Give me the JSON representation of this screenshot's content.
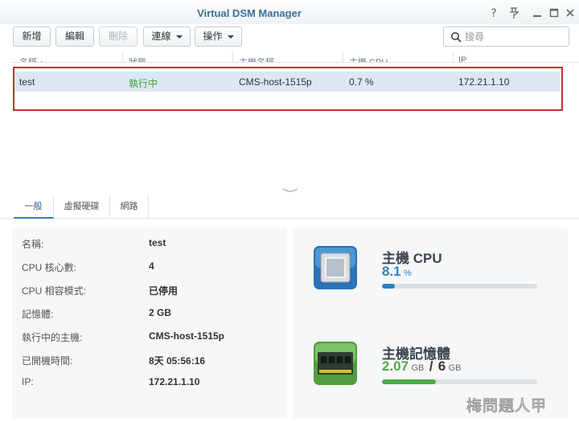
{
  "window": {
    "title": "Virtual DSM Manager",
    "controls": [
      "question-icon",
      "pin-icon",
      "minimize-icon",
      "maximize-icon",
      "close-icon"
    ]
  },
  "toolbar": {
    "create_label": "新增",
    "edit_label": "編輯",
    "delete_label": "刪除",
    "connect_label": "連線",
    "action_label": "操作",
    "search_placeholder": "搜尋"
  },
  "grid": {
    "columns": [
      "名稱",
      "狀態",
      "主機名稱",
      "主機 CPU",
      "IP"
    ],
    "rows": [
      {
        "name": "test",
        "status": "執行中",
        "host": "CMS-host-1515p",
        "cpu": "0.7 %",
        "ip": "172.21.1.10"
      }
    ]
  },
  "tabs": [
    "一般",
    "虛擬硬碟",
    "網路"
  ],
  "general": {
    "items": [
      {
        "label": "名稱:",
        "value": "test"
      },
      {
        "label": "CPU 核心數:",
        "value": "4"
      },
      {
        "label": "CPU 相容模式:",
        "value": "已停用"
      },
      {
        "label": "記憶體:",
        "value": "2 GB"
      },
      {
        "label": "執行中的主機:",
        "value": "CMS-host-1515p"
      },
      {
        "label": "已開機時間:",
        "value": "8天 05:56:16"
      },
      {
        "label": "IP:",
        "value": "172.21.1.10"
      }
    ]
  },
  "stats": {
    "cpu": {
      "title": "主機 CPU",
      "value": "8.1",
      "unit": "%",
      "usage_fraction": 0.081
    },
    "memory": {
      "title": "主機記憶體",
      "used": "2.07",
      "used_unit": "GB",
      "separator": "/",
      "total": "6",
      "total_unit": "GB",
      "usage_fraction": 0.345
    }
  },
  "colors": {
    "title": "#3b6f96",
    "running_status": "#3aa12a",
    "cpu_accent": "#2b7fc0",
    "memory_accent": "#4caa47",
    "selected_row": "#dbe8f4",
    "highlight_box": "#d9272e"
  },
  "watermark": "梅問題人甲"
}
